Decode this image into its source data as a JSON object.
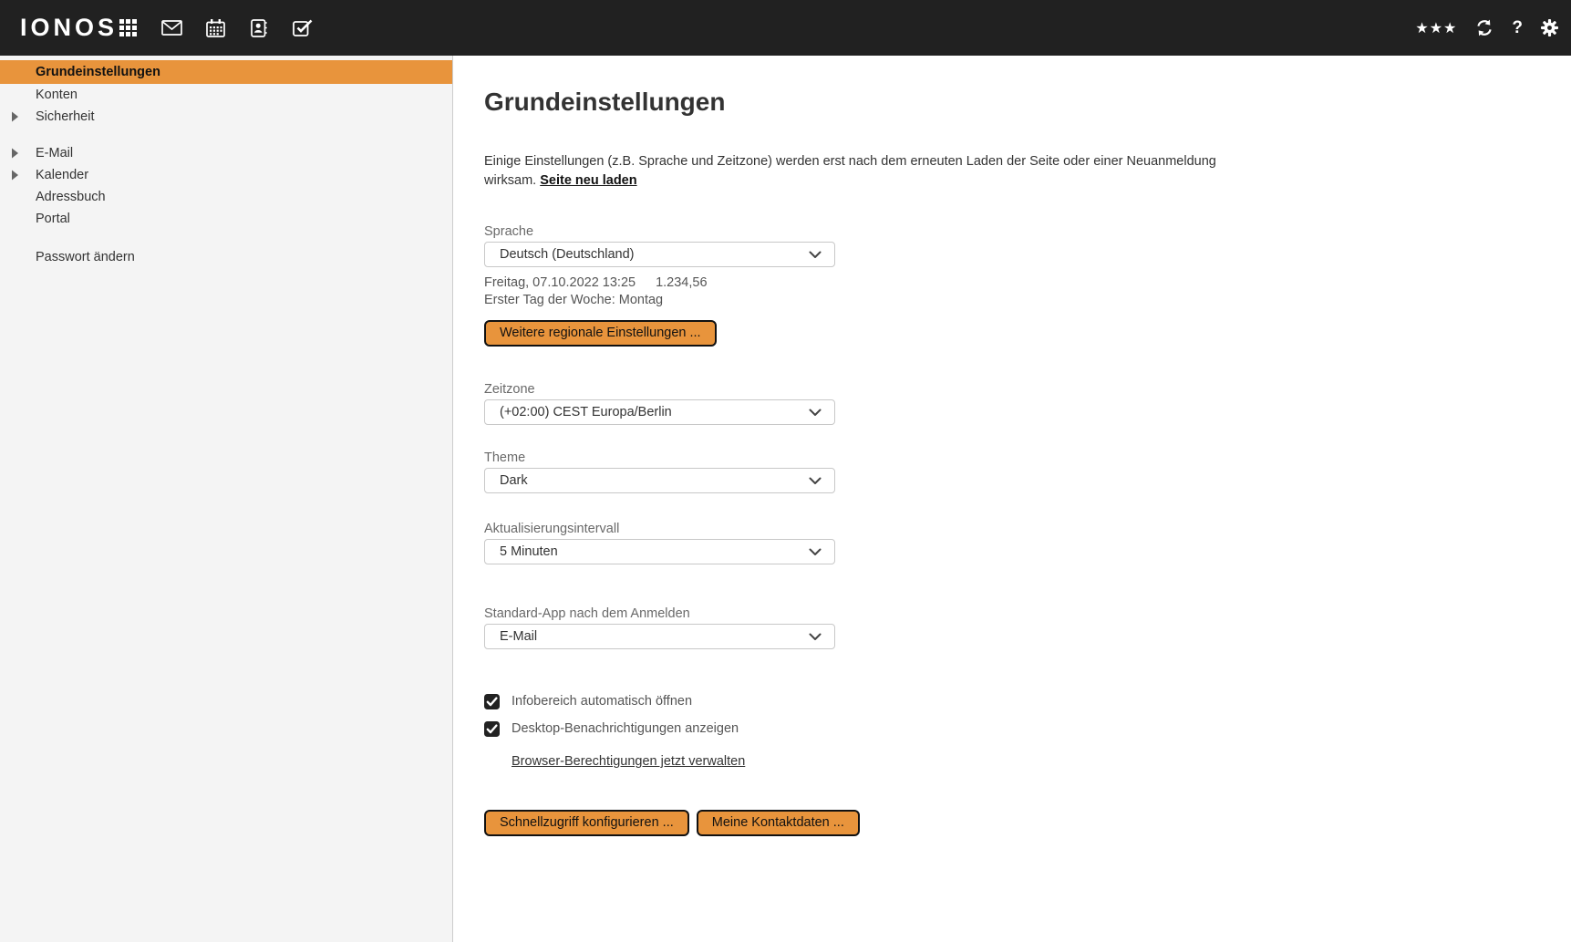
{
  "topbar": {
    "logo": "IONOS",
    "right": {
      "premium_stars_glyph": "★★★",
      "help_glyph": "?"
    }
  },
  "colors": {
    "topbar_bg": "#212121",
    "accent_orange": "#E8943C",
    "sidebar_bg": "#F4F4F4",
    "border_gray": "#CCCCCC"
  },
  "sidebar": {
    "items": [
      {
        "label": "Grundeinstellungen",
        "selected": true
      },
      {
        "label": "Konten"
      },
      {
        "label": "Sicherheit",
        "expandable": true
      },
      {
        "label": "E-Mail",
        "expandable": true
      },
      {
        "label": "Kalender",
        "expandable": true
      },
      {
        "label": "Adressbuch"
      },
      {
        "label": "Portal"
      },
      {
        "label": "Passwort ändern"
      }
    ]
  },
  "main": {
    "title": "Grundeinstellungen",
    "notice_text": "Einige Einstellungen (z.B. Sprache und Zeitzone) werden erst nach dem erneuten Laden der Seite oder einer Neuanmeldung wirksam.",
    "notice_link": "Seite neu laden",
    "language": {
      "label": "Sprache",
      "value": "Deutsch (Deutschland)",
      "preview_datetime": "Freitag, 07.10.2022 13:25",
      "preview_number": "1.234,56",
      "first_day_line": "Erster Tag der Woche: Montag",
      "regional_button": "Weitere regionale Einstellungen ..."
    },
    "timezone": {
      "label": "Zeitzone",
      "value": "(+02:00) CEST Europa/Berlin"
    },
    "theme": {
      "label": "Theme",
      "value": "Dark"
    },
    "refresh_interval": {
      "label": "Aktualisierungsintervall",
      "value": "5 Minuten"
    },
    "default_app": {
      "label": "Standard-App nach dem Anmelden",
      "value": "E-Mail"
    },
    "checkboxes": [
      {
        "label": "Infobereich automatisch öffnen",
        "checked": true
      },
      {
        "label": "Desktop-Benachrichtigungen anzeigen",
        "checked": true
      }
    ],
    "permissions_link": "Browser-Berechtigungen jetzt verwalten",
    "footer_buttons": [
      {
        "label": "Schnellzugriff konfigurieren ..."
      },
      {
        "label": "Meine Kontaktdaten ..."
      }
    ]
  }
}
